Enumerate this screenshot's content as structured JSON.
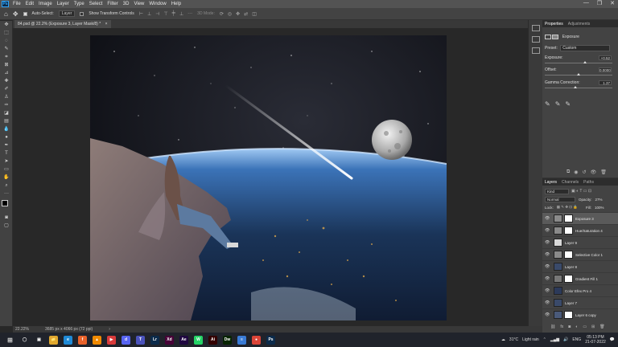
{
  "app": {
    "logo": "Ps",
    "menus": [
      "File",
      "Edit",
      "Image",
      "Layer",
      "Type",
      "Select",
      "Filter",
      "3D",
      "View",
      "Window",
      "Help"
    ],
    "window_controls": [
      "—",
      "❐",
      "✕"
    ]
  },
  "options_bar": {
    "auto_select_label": "Auto-Select:",
    "auto_select_value": "Layer",
    "transform_controls_label": "Show Transform Controls",
    "mode_label": "3D Mode:"
  },
  "document": {
    "tab_title": "84.psd @ 22.2% (Exposure 3, Layer Mask/8) *",
    "close_glyph": "×"
  },
  "status": {
    "zoom": "22.22%",
    "dimensions": "3685 px x 4066 px (72 ppi)"
  },
  "properties_panel": {
    "tabs": [
      "Properties",
      "Adjustments"
    ],
    "adjustment_name": "Exposure",
    "preset_label": "Preset:",
    "preset_value": "Custom",
    "exposure_label": "Exposure:",
    "exposure_value": "+0.52",
    "exposure_fraction": 0.6,
    "offset_label": "Offset:",
    "offset_value": "0.0000",
    "offset_fraction": 0.5,
    "gamma_label": "Gamma Correction:",
    "gamma_value": "1.37",
    "gamma_fraction": 0.45,
    "eyedroppers": [
      "eyedropper-black",
      "eyedropper-gray",
      "eyedropper-white"
    ]
  },
  "layers_panel": {
    "tabs": [
      "Layers",
      "Channels",
      "Paths"
    ],
    "filter_kind": "Kind",
    "blend_mode": "Normal",
    "opacity_label": "Opacity:",
    "opacity_value": "27%",
    "lock_label": "Lock:",
    "fill_label": "Fill:",
    "fill_value": "100%",
    "layers": [
      {
        "name": "Exposure 3",
        "selected": true,
        "thumb_color": "#8a8a8a",
        "has_mask": true
      },
      {
        "name": "Hue/Saturation 4",
        "selected": false,
        "thumb_color": "#8a8a8a",
        "has_mask": true
      },
      {
        "name": "Layer 9",
        "selected": false,
        "thumb_color": "#d8d8d8",
        "has_mask": false
      },
      {
        "name": "Selective Color 1",
        "selected": false,
        "thumb_color": "#8a8a8a",
        "has_mask": true
      },
      {
        "name": "Layer 8",
        "selected": false,
        "thumb_color": "#3a4a6a",
        "has_mask": false
      },
      {
        "name": "Gradient Fill 1",
        "selected": false,
        "thumb_color": "#777777",
        "has_mask": true
      },
      {
        "name": "Color Efex Pro 4",
        "selected": false,
        "thumb_color": "#2c3a5a",
        "has_mask": false
      },
      {
        "name": "Layer 7",
        "selected": false,
        "thumb_color": "#3a4a6a",
        "has_mask": false
      },
      {
        "name": "Layer 6 copy",
        "selected": false,
        "thumb_color": "#4a5a7a",
        "has_mask": true
      }
    ]
  },
  "taskbar": {
    "apps": [
      {
        "name": "cortana",
        "label": "◯",
        "color": "#20232b"
      },
      {
        "name": "task-view",
        "label": "▣",
        "color": "#20232b"
      },
      {
        "name": "file-explorer",
        "label": "📁",
        "color": "#e0a82e"
      },
      {
        "name": "edge",
        "label": "e",
        "color": "#1f8ad6"
      },
      {
        "name": "firefox",
        "label": "f",
        "color": "#e8622a"
      },
      {
        "name": "vlc",
        "label": "▲",
        "color": "#f08a00"
      },
      {
        "name": "cast",
        "label": "▶",
        "color": "#d93b3b"
      },
      {
        "name": "discord",
        "label": "d",
        "color": "#5865f2"
      },
      {
        "name": "teams",
        "label": "T",
        "color": "#4b53bc"
      },
      {
        "name": "lightroom",
        "label": "Lr",
        "color": "#0b2a4a"
      },
      {
        "name": "adobe-xd",
        "label": "Xd",
        "color": "#470137"
      },
      {
        "name": "after-effects",
        "label": "Ae",
        "color": "#1f0740"
      },
      {
        "name": "whatsapp",
        "label": "W",
        "color": "#25d366"
      },
      {
        "name": "illustrator",
        "label": "Ai",
        "color": "#330000"
      },
      {
        "name": "dreamweaver",
        "label": "Dw",
        "color": "#072401"
      },
      {
        "name": "notepad",
        "label": "≡",
        "color": "#3a7bd5"
      },
      {
        "name": "chrome",
        "label": "●",
        "color": "#db4437"
      },
      {
        "name": "photoshop",
        "label": "Ps",
        "color": "#0b2a4a"
      }
    ],
    "weather_temp": "31°C",
    "weather_text": "Light rain",
    "language": "ENG",
    "time": "05:13 PM",
    "date": "21-07-2022"
  }
}
